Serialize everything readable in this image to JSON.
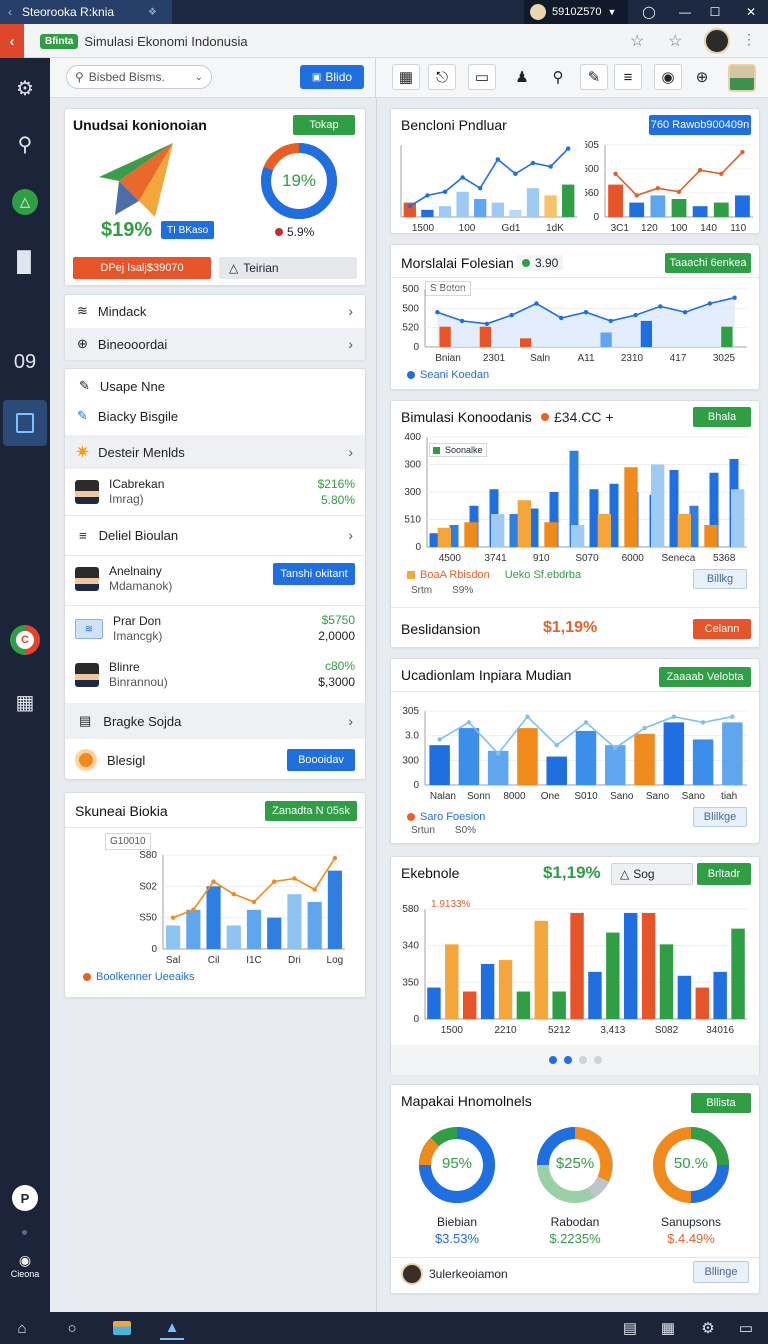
{
  "window": {
    "tab_title": "Steorooka R:knia",
    "account": "5910Z570",
    "minimize": "—",
    "maximize": "☐",
    "close": "✕"
  },
  "browser": {
    "badge": "Bfinta",
    "title": "Simulasi Ekonomi Indonusia"
  },
  "sidebar": {
    "clock": "09",
    "profile_label": "Cieona"
  },
  "toolbar": {
    "search_placeholder": "Bisbed Bisms.",
    "button": "Blido"
  },
  "kpi": {
    "title": "Unudsai konionoian",
    "tag": "Tokap",
    "value": "$19%",
    "chip": "TI BKaso",
    "donut_value": "19%",
    "donut_pct": 0.19,
    "donut_sub": "5.9%",
    "orange_btn": "DPej Isalj$39070",
    "grey_btn": "Teirian"
  },
  "menu1": {
    "items": [
      "Mindack",
      "Bineooordai"
    ]
  },
  "list": {
    "rows": [
      {
        "label": "Usape Nne"
      },
      {
        "label": "Biacky Bisgile"
      },
      {
        "label": "Desteir Menlds"
      },
      {
        "name": "ICabrekan",
        "sub": "Imrag)",
        "v1": "$216%",
        "v2": "5.80%"
      },
      {
        "label": "Deliel Bioulan"
      },
      {
        "name": "Anelnainy",
        "sub": "Mdamanok)",
        "btn": "Tanshi okitant"
      },
      {
        "name": "Prar Don",
        "sub": "Imancgk)",
        "v1": "$5750",
        "v2": "2,0000"
      },
      {
        "name": "Blinre",
        "sub": "Binrannou)",
        "v1": "c80%",
        "v2": "$,3000"
      },
      {
        "label": "Bragke Sojda"
      },
      {
        "label": "Blesigl",
        "btn": "Boooidav"
      }
    ]
  },
  "chartL": {
    "title": "Skuneai Biokia",
    "tag": "Zanadta N 05sk",
    "box": "G10010",
    "legend": "Boolkenner Ueeaiks"
  },
  "c1": {
    "title": "Bencloni Pndluar",
    "tag": "760 Rawob900409n"
  },
  "c2": {
    "title": "Morslalai Folesian",
    "metric": "3.90",
    "tag": "Taaachi 6enkea",
    "box": "S Boton",
    "legend": "Seani Koedan"
  },
  "c3": {
    "title": "Bimulasi Konoodanis",
    "metric": "£34.CC +",
    "tag": "Bhala",
    "box": "Soonalke",
    "legend_a": "BoaA Rbisdon",
    "legend_b": "Ueko Sf.ebdrba",
    "stat_a": "Srtm",
    "stat_b": "S9%",
    "lbtn": "Billkg",
    "footer_label": "Beslidansion",
    "footer_value": "$1,19%",
    "footer_btn": "Celann"
  },
  "c4": {
    "title": "Ucadionlam Inpiara Mudian",
    "tag": "Zaaaab Velobta",
    "legend": "Saro Foesion",
    "stat_a": "Srtun",
    "stat_b": "S0%",
    "lbtn": "Blilkge"
  },
  "c5": {
    "title": "Ekebnole",
    "metric": "$1,19%",
    "search": "Sog",
    "btn": "Brltadr",
    "label": "1.9133%"
  },
  "c6": {
    "title": "Mapakai Hnomolnels",
    "tag": "Bllista",
    "donuts": [
      {
        "value": "95%",
        "name": "Biebian",
        "money": "$3.53%"
      },
      {
        "value": "$25%",
        "name": "Rabodan",
        "money": "$.2235%"
      },
      {
        "value": "50.%",
        "name": "Sanupsons",
        "money": "$.4.49%"
      }
    ],
    "user": "3ulerkeoiamon",
    "lbtn": "Bllinge"
  },
  "chart_data": [
    {
      "id": "skuneai",
      "type": "bar",
      "categories": [
        "Sal",
        "",
        "Cil",
        "",
        "I1C",
        "",
        "Dri",
        "",
        "Log"
      ],
      "series": [
        {
          "values": [
            15,
            25,
            40,
            15,
            25,
            20,
            35,
            30,
            50
          ]
        },
        {
          "type": "line",
          "values": [
            20,
            25,
            43,
            35,
            30,
            43,
            45,
            38,
            58
          ]
        }
      ],
      "yticks": [
        "0",
        "S50",
        "S02",
        "S80"
      ]
    },
    {
      "id": "bencloni-a",
      "type": "bar",
      "categories": [
        "1500",
        "100",
        "Gd1",
        "1dK"
      ],
      "series": [
        {
          "values": [
            20,
            10,
            15,
            35,
            25,
            20,
            10,
            40,
            30,
            45
          ]
        },
        {
          "type": "line",
          "values": [
            15,
            30,
            35,
            55,
            40,
            80,
            60,
            75,
            70,
            95
          ]
        }
      ]
    },
    {
      "id": "bencloni-b",
      "type": "bar",
      "categories": [
        "3C1",
        "120",
        "100",
        "140",
        "110"
      ],
      "series": [
        {
          "values": [
            45,
            20,
            30,
            25,
            15,
            20,
            30
          ]
        },
        {
          "type": "line",
          "values": [
            60,
            30,
            40,
            35,
            65,
            60,
            90
          ]
        }
      ],
      "yticks": [
        "0",
        "560",
        "500",
        "505"
      ]
    },
    {
      "id": "morslalai",
      "type": "area",
      "categories": [
        "Bnian",
        "2301",
        "Saln",
        "A11",
        "2310",
        "417",
        "3025"
      ],
      "series": [
        {
          "values": [
            60,
            45,
            40,
            55,
            75,
            50,
            60,
            45,
            55,
            70,
            60,
            75,
            85
          ]
        },
        {
          "type": "bar",
          "values": [
            35,
            35,
            15,
            0,
            25,
            45,
            0,
            35
          ]
        }
      ],
      "yticks": [
        "0",
        "520",
        "500",
        "500"
      ]
    },
    {
      "id": "bimulasi",
      "type": "bar",
      "categories": [
        "4500",
        "3741",
        "910",
        "S070",
        "6000",
        "Seneca",
        "5368"
      ],
      "series": [
        {
          "values": [
            50,
            80,
            150,
            210,
            120,
            140,
            200,
            350,
            210,
            230,
            200,
            190,
            280,
            150,
            270,
            320
          ]
        },
        {
          "values": [
            70,
            90,
            120,
            170,
            90,
            80,
            120,
            290,
            300,
            120,
            80,
            210
          ]
        }
      ],
      "yticks": [
        "0",
        "510",
        "300",
        "300",
        "400"
      ]
    },
    {
      "id": "ucadionlam",
      "type": "bar",
      "categories": [
        "Nalan",
        "Sonn",
        "8000",
        "One",
        "S010",
        "Sano",
        "Sano",
        "Sano",
        "tiah"
      ],
      "series": [
        {
          "values": [
            70,
            100,
            60,
            100,
            50,
            95,
            70,
            90,
            110,
            80,
            110
          ]
        },
        {
          "type": "line",
          "values": [
            80,
            110,
            55,
            120,
            70,
            110,
            65,
            100,
            120,
            110,
            120
          ]
        }
      ],
      "yticks": [
        "0",
        "300",
        "3.0",
        "305"
      ]
    },
    {
      "id": "ekebnole",
      "type": "bar",
      "categories": [
        "1500",
        "2210",
        "5212",
        "3,413",
        "S082",
        "34016"
      ],
      "series": [
        {
          "values": [
            80,
            190,
            70,
            140,
            150,
            70,
            250,
            70,
            270,
            120,
            220,
            270,
            270,
            190,
            110,
            80,
            120,
            230
          ]
        }
      ],
      "yticks": [
        "0",
        "350",
        "340",
        "580"
      ]
    }
  ]
}
